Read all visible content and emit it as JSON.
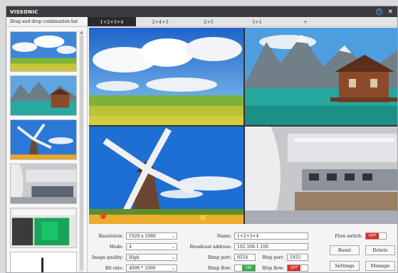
{
  "window": {
    "title": "VISSONIC"
  },
  "icons": {
    "info": "info-icon",
    "close": "close-icon"
  },
  "sidebar": {
    "title": "Drag and drop combination list"
  },
  "tabs": [
    {
      "label": "1+2+3+4",
      "active": true
    },
    {
      "label": "2+4+3",
      "active": false
    },
    {
      "label": "2+5",
      "active": false
    },
    {
      "label": "5+1",
      "active": false
    },
    {
      "label": "+",
      "active": false
    }
  ],
  "settings": {
    "resolution_label": "Resolution:",
    "resolution_value": "1920 x 1080",
    "mode_label": "Mode:",
    "mode_value": "4",
    "quality_label": "Image quality:",
    "quality_value": "High",
    "bitrate_label": "Bit rate:",
    "bitrate_value": "4096 * 1000",
    "name_label": "Name:",
    "name_value": "1+2+3+4",
    "broadcast_label": "Broadcast address:",
    "broadcast_value": "192.168.1.100",
    "rtmp_port_label": "Rtmp port:",
    "rtmp_port_value": "9554",
    "rtsp_port_label": "Rtsp port:",
    "rtsp_port_value": "1935",
    "rtmp_flow_label": "Rtmp flow:",
    "rtmp_flow_value": "ON",
    "rtsp_flow_label": "Rtsp flow:",
    "rtsp_flow_value": "OFF",
    "flow_switch_label": "Flow switch:",
    "flow_switch_value": "OFF"
  },
  "buttons": {
    "reset": "Reset",
    "delete": "Delete",
    "settings": "Settings",
    "manage": "Manage"
  },
  "colors": {
    "on": "#2fae4a",
    "off": "#e02a2a",
    "active_tab": "#2a2a2c"
  }
}
